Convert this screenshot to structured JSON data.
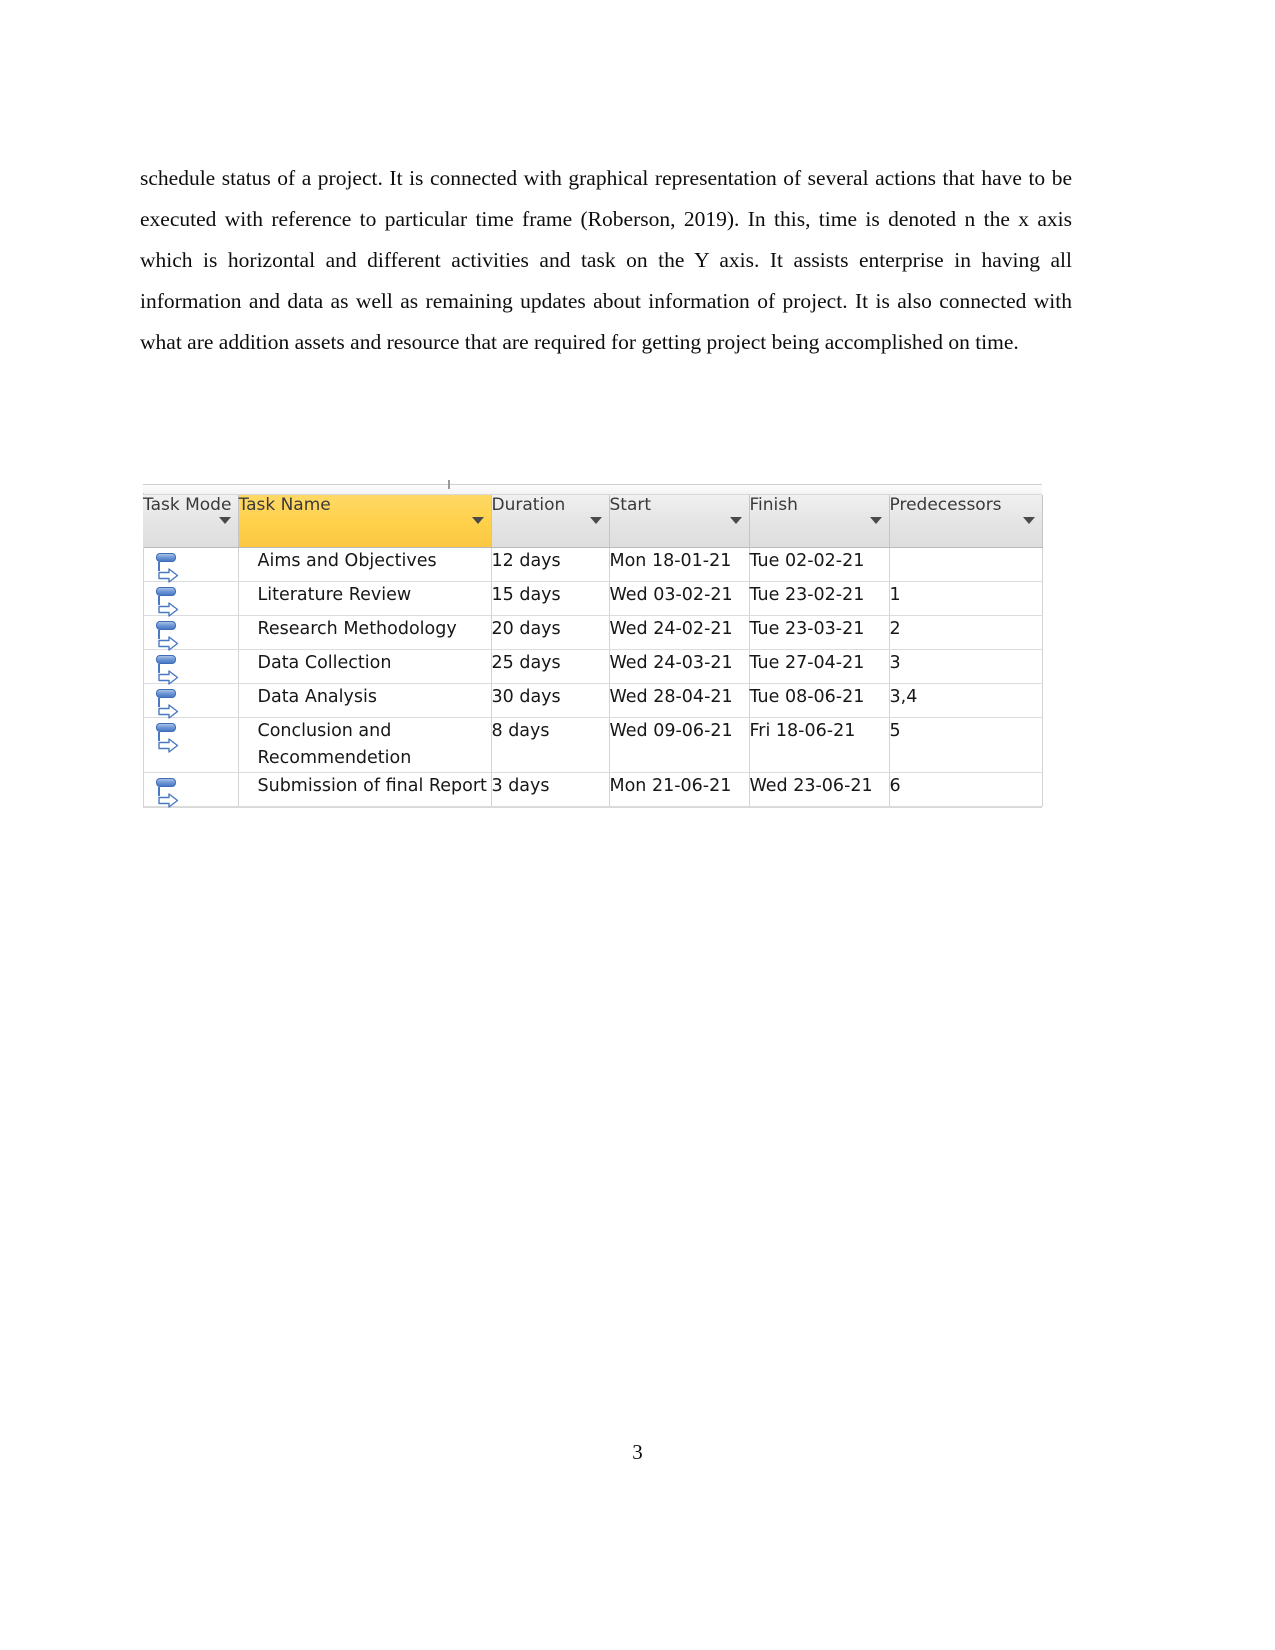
{
  "document": {
    "paragraph": "schedule status of a project. It is connected with graphical representation of several actions that have to be executed with reference to particular time frame (Roberson, 2019). In this, time is denoted n the x axis which is horizontal and different activities and task on the Y axis. It assists enterprise in having all information and data as well as remaining updates about information of project. It is also connected with what are addition assets and resource that are required for getting project being accomplished on time.",
    "page_number": "3"
  },
  "project_table": {
    "columns": [
      {
        "key": "task_mode",
        "label": "Task Mode",
        "highlighted": false,
        "has_filter_arrow": true
      },
      {
        "key": "task_name",
        "label": "Task Name",
        "highlighted": true,
        "has_filter_arrow": true
      },
      {
        "key": "duration",
        "label": "Duration",
        "highlighted": false,
        "has_filter_arrow": true
      },
      {
        "key": "start",
        "label": "Start",
        "highlighted": false,
        "has_filter_arrow": true
      },
      {
        "key": "finish",
        "label": "Finish",
        "highlighted": false,
        "has_filter_arrow": true
      },
      {
        "key": "predecessors",
        "label": "Predecessors",
        "highlighted": false,
        "has_filter_arrow": true
      }
    ],
    "highlight_color": "#ffd04a",
    "header_color": "#e4e4e4",
    "task_mode_icon": "auto-scheduled-icon",
    "rows": [
      {
        "task_mode": "auto-scheduled-icon",
        "task_name": "Aims and Objectives",
        "duration": "12 days",
        "start": "Mon 18-01-21",
        "finish": "Tue 02-02-21",
        "predecessors": ""
      },
      {
        "task_mode": "auto-scheduled-icon",
        "task_name": "Literature Review",
        "duration": "15 days",
        "start": "Wed 03-02-21",
        "finish": "Tue 23-02-21",
        "predecessors": "1"
      },
      {
        "task_mode": "auto-scheduled-icon",
        "task_name": "Research Methodology",
        "duration": "20 days",
        "start": "Wed 24-02-21",
        "finish": "Tue 23-03-21",
        "predecessors": "2"
      },
      {
        "task_mode": "auto-scheduled-icon",
        "task_name": "Data Collection",
        "duration": "25 days",
        "start": "Wed 24-03-21",
        "finish": "Tue 27-04-21",
        "predecessors": "3"
      },
      {
        "task_mode": "auto-scheduled-icon",
        "task_name": "Data Analysis",
        "duration": "30 days",
        "start": "Wed 28-04-21",
        "finish": "Tue 08-06-21",
        "predecessors": "3,4"
      },
      {
        "task_mode": "auto-scheduled-icon",
        "task_name": "Conclusion and Recommendetion",
        "duration": "8 days",
        "start": "Wed 09-06-21",
        "finish": "Fri 18-06-21",
        "predecessors": "5"
      },
      {
        "task_mode": "auto-scheduled-icon",
        "task_name": "Submission of final Report",
        "duration": "3 days",
        "start": "Mon 21-06-21",
        "finish": "Wed 23-06-21",
        "predecessors": "6"
      }
    ]
  }
}
